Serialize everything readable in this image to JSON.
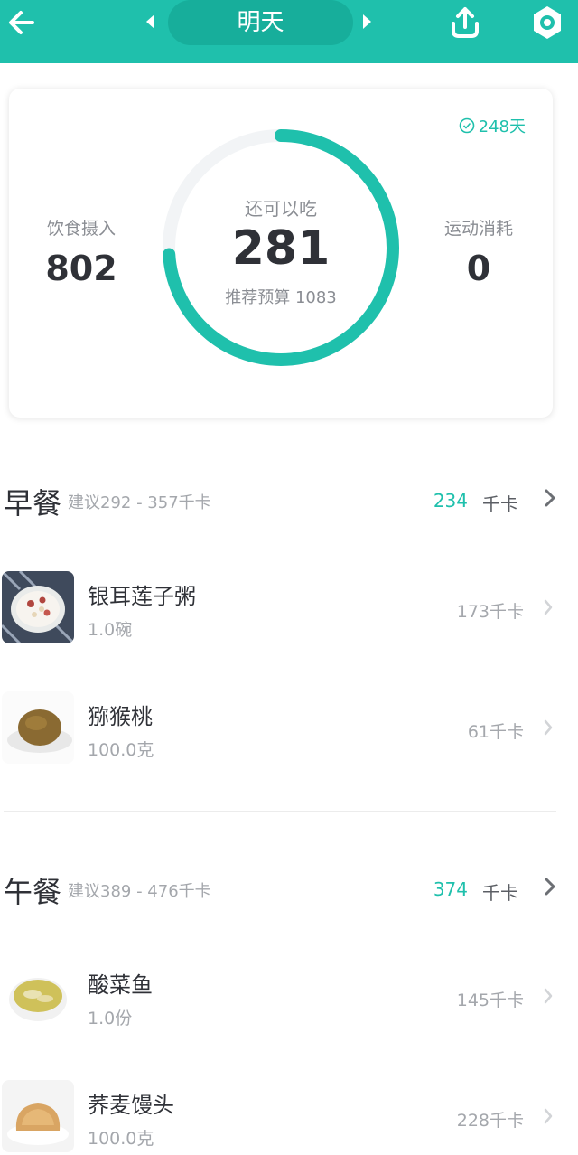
{
  "header": {
    "date_label": "明天",
    "colors": {
      "accent": "#1fc0ac",
      "pill": "#17ae9b"
    }
  },
  "summary": {
    "streak": "248天",
    "intake_label": "饮食摄入",
    "intake_value": "802",
    "remaining_label": "还可以吃",
    "remaining_value": "281",
    "budget_text": "推荐预算 1083",
    "burn_label": "运动消耗",
    "burn_value": "0",
    "ring_progress": 0.74
  },
  "meals": [
    {
      "title": "早餐",
      "suggestion": "建议292 - 357千卡",
      "total": "234",
      "unit": "千卡",
      "items": [
        {
          "name": "银耳莲子粥",
          "amount": "1.0碗",
          "calories": "173千卡",
          "icon": "porridge-icon"
        },
        {
          "name": "猕猴桃",
          "amount": "100.0克",
          "calories": "61千卡",
          "icon": "kiwi-icon"
        }
      ]
    },
    {
      "title": "午餐",
      "suggestion": "建议389 - 476千卡",
      "total": "374",
      "unit": "千卡",
      "items": [
        {
          "name": "酸菜鱼",
          "amount": "1.0份",
          "calories": "145千卡",
          "icon": "fish-soup-icon"
        },
        {
          "name": "荞麦馒头",
          "amount": "100.0克",
          "calories": "228千卡",
          "icon": "steamed-bun-icon"
        }
      ]
    }
  ]
}
